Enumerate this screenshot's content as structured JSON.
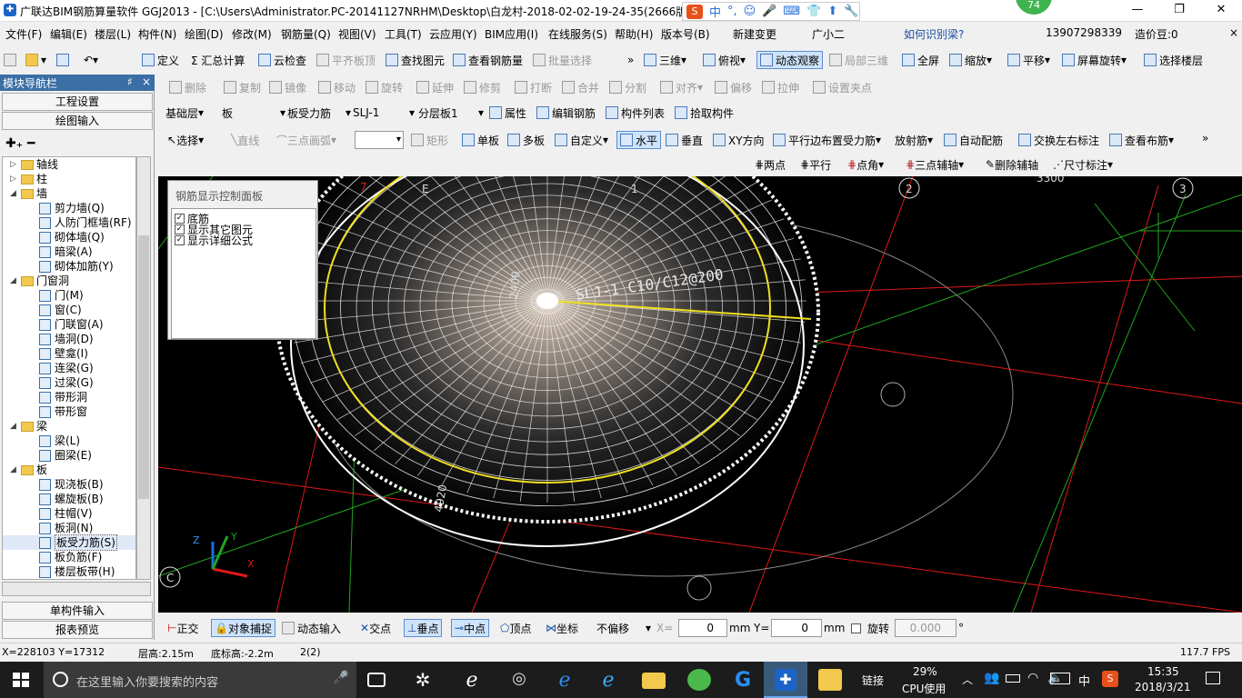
{
  "window": {
    "title": "广联达BIM钢筋算量软件 GGJ2013 - [C:\\Users\\Administrator.PC-20141127NRHM\\Desktop\\白龙村-2018-02-02-19-24-35(2666版",
    "minimize": "—",
    "maximize": "❐",
    "close": "✕",
    "badge": "74",
    "ime_items": [
      "中",
      "°,",
      "☺",
      "🎤",
      "⌨",
      "👕",
      "⬆",
      "🔧"
    ]
  },
  "menu": {
    "items": [
      "文件(F)",
      "编辑(E)",
      "楼层(L)",
      "构件(N)",
      "绘图(D)",
      "修改(M)",
      "钢筋量(Q)",
      "视图(V)",
      "工具(T)",
      "云应用(Y)",
      "BIM应用(I)",
      "在线服务(S)",
      "帮助(H)",
      "版本号(B)",
      "新建变更",
      "广小二"
    ],
    "question": "如何识别梁?",
    "phone": "13907298339",
    "points": "造价豆:0"
  },
  "toolbar1": {
    "items": [
      "定义",
      "Σ 汇总计算",
      "云检查",
      "平齐板顶",
      "查找图元",
      "查看钢筋量",
      "批量选择"
    ],
    "right": [
      "三维",
      "俯视",
      "动态观察",
      "局部三维",
      "全屏",
      "缩放",
      "平移",
      "屏幕旋转",
      "选择楼层"
    ]
  },
  "toolbar2": {
    "items": [
      "删除",
      "复制",
      "镜像",
      "移动",
      "旋转",
      "延伸",
      "修剪",
      "打断",
      "合并",
      "分割",
      "对齐",
      "偏移",
      "拉伸",
      "设置夹点"
    ]
  },
  "toolbar3": {
    "floor": "基础层",
    "category": "板",
    "type": "板受力筋",
    "element": "SLJ-1",
    "layer": "分层板1",
    "items": [
      "属性",
      "编辑钢筋",
      "构件列表",
      "拾取构件"
    ]
  },
  "toolbar4": {
    "items": [
      "选择",
      "直线",
      "三点画弧",
      "矩形",
      "单板",
      "多板",
      "自定义",
      "水平",
      "垂直",
      "XY方向",
      "平行边布置受力筋",
      "放射筋",
      "自动配筋",
      "交换左右标注",
      "查看布筋"
    ]
  },
  "toolbar5": {
    "items": [
      "两点",
      "平行",
      "点角",
      "三点辅轴",
      "删除辅轴",
      "尺寸标注"
    ]
  },
  "left_panel": {
    "title": "模块导航栏",
    "pin": "♯",
    "close": "×",
    "buttons": [
      "工程设置",
      "绘图输入",
      "单构件输入",
      "报表预览"
    ],
    "tree": [
      {
        "label": "轴线",
        "level": 0,
        "expand": "▷"
      },
      {
        "label": "柱",
        "level": 0,
        "expand": "▷"
      },
      {
        "label": "墙",
        "level": 0,
        "expand": "◢"
      },
      {
        "label": "剪力墙(Q)",
        "level": 1
      },
      {
        "label": "人防门框墙(RF)",
        "level": 1
      },
      {
        "label": "砌体墙(Q)",
        "level": 1
      },
      {
        "label": "暗梁(A)",
        "level": 1
      },
      {
        "label": "砌体加筋(Y)",
        "level": 1
      },
      {
        "label": "门窗洞",
        "level": 0,
        "expand": "◢"
      },
      {
        "label": "门(M)",
        "level": 1
      },
      {
        "label": "窗(C)",
        "level": 1
      },
      {
        "label": "门联窗(A)",
        "level": 1
      },
      {
        "label": "墙洞(D)",
        "level": 1
      },
      {
        "label": "壁龛(I)",
        "level": 1
      },
      {
        "label": "连梁(G)",
        "level": 1
      },
      {
        "label": "过梁(G)",
        "level": 1
      },
      {
        "label": "带形洞",
        "level": 1
      },
      {
        "label": "带形窗",
        "level": 1
      },
      {
        "label": "梁",
        "level": 0,
        "expand": "◢"
      },
      {
        "label": "梁(L)",
        "level": 1
      },
      {
        "label": "圈梁(E)",
        "level": 1
      },
      {
        "label": "板",
        "level": 0,
        "expand": "◢"
      },
      {
        "label": "现浇板(B)",
        "level": 1
      },
      {
        "label": "螺旋板(B)",
        "level": 1
      },
      {
        "label": "柱帽(V)",
        "level": 1
      },
      {
        "label": "板洞(N)",
        "level": 1
      },
      {
        "label": "板受力筋(S)",
        "level": 1,
        "selected": true
      },
      {
        "label": "板负筋(F)",
        "level": 1
      },
      {
        "label": "楼层板带(H)",
        "level": 1
      }
    ]
  },
  "control_panel": {
    "title": "钢筋显示控制面板",
    "options": [
      "底筋",
      "显示其它图元",
      "显示详细公式"
    ]
  },
  "viewport": {
    "rebar_label": "SLJ-1 C10/C12@200",
    "dim_2400": "2400",
    "dim_4920": "4920",
    "dim_3300": "3300",
    "axis_labels": [
      "7",
      "E",
      "1",
      "2",
      "3"
    ],
    "axis_c": "C",
    "axis_z": "Z",
    "axis_y": "Y",
    "axis_x": "X"
  },
  "snapbar": {
    "items": [
      "正交",
      "对象捕捉",
      "动态输入",
      "交点",
      "垂点",
      "中点",
      "顶点",
      "坐标"
    ],
    "offset_mode": "不偏移",
    "x_label": "X=",
    "x_value": "0",
    "x_unit": "mm",
    "y_label": "Y=",
    "y_value": "0",
    "y_unit": "mm",
    "rotate_label": "旋转",
    "rotate_value": "0.000",
    "deg": "°"
  },
  "status": {
    "coords": "X=228103 Y=17312",
    "floor_height": "层高:2.15m",
    "bottom_elev": "底标高:-2.2m",
    "count": "2(2)",
    "fps": "117.7 FPS"
  },
  "taskbar": {
    "search_placeholder": "在这里输入你要搜索的内容",
    "link": "链接",
    "cpu_pct": "29%",
    "cpu_label": "CPU使用",
    "ime": "中",
    "time": "15:35",
    "date": "2018/3/21"
  },
  "colors": {
    "viewport_bg": "#000000",
    "grid_red": "#e01818",
    "grid_green": "#1fa51f",
    "ring_yellow": "#f0e020",
    "titlebar_blue": "#3a6ea5"
  }
}
